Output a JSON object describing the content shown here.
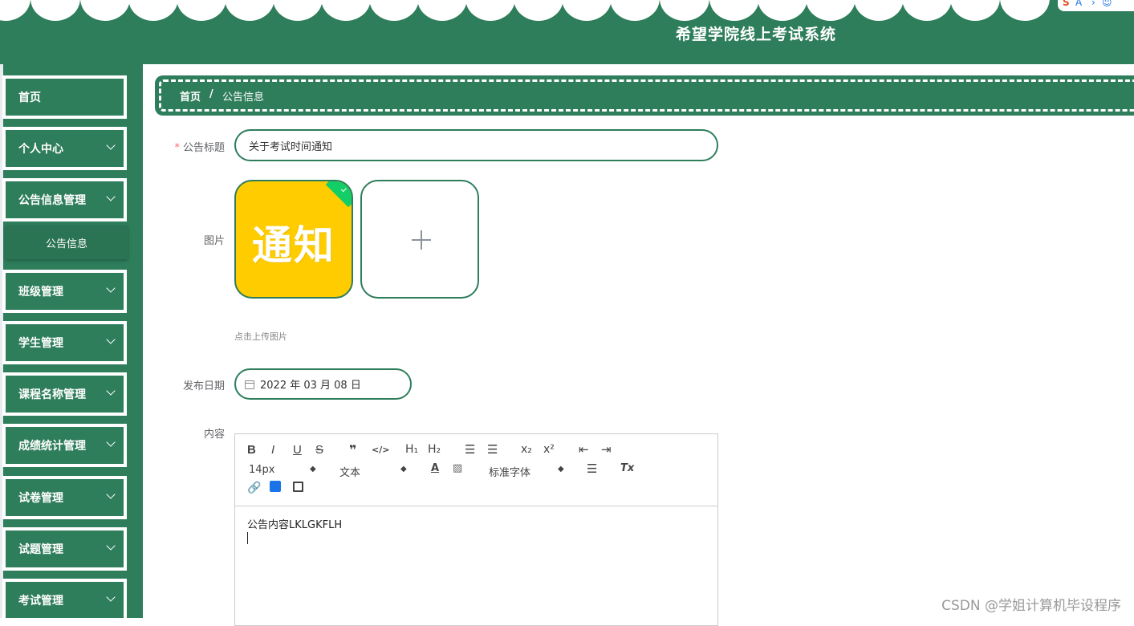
{
  "header": {
    "title": "希望学院线上考试系统"
  },
  "sidebar": {
    "items": [
      {
        "label": "首页"
      },
      {
        "label": "个人中心"
      },
      {
        "label": "公告信息管理"
      },
      {
        "label": "班级管理"
      },
      {
        "label": "学生管理"
      },
      {
        "label": "课程名称管理"
      },
      {
        "label": "成绩统计管理"
      },
      {
        "label": "试卷管理"
      },
      {
        "label": "试题管理"
      },
      {
        "label": "考试管理"
      }
    ],
    "sub_item": {
      "label": "公告信息"
    }
  },
  "breadcrumb": {
    "home": "首页",
    "separator": "/",
    "current": "公告信息"
  },
  "form": {
    "title_label": "公告标题",
    "title_value": "关于考试时间通知",
    "image_label": "图片",
    "image_text": "通知",
    "upload_tip": "点击上传图片",
    "date_label": "发布日期",
    "date_value": "2022 年 03 月 08 日",
    "content_label": "内容"
  },
  "editor": {
    "toolbar": {
      "bold": "B",
      "italic": "I",
      "underline": "U",
      "strike": "S",
      "blockquote": "❞",
      "code": "</>",
      "h1": "H₁",
      "h2": "H₂",
      "subscript": "x₂",
      "superscript": "x²",
      "size": "14px",
      "header": "文本",
      "font": "标准字体",
      "clean": "Tx"
    },
    "content": "公告内容LKLGKFLH"
  },
  "watermark": "CSDN @学姐计算机毕设程序"
}
